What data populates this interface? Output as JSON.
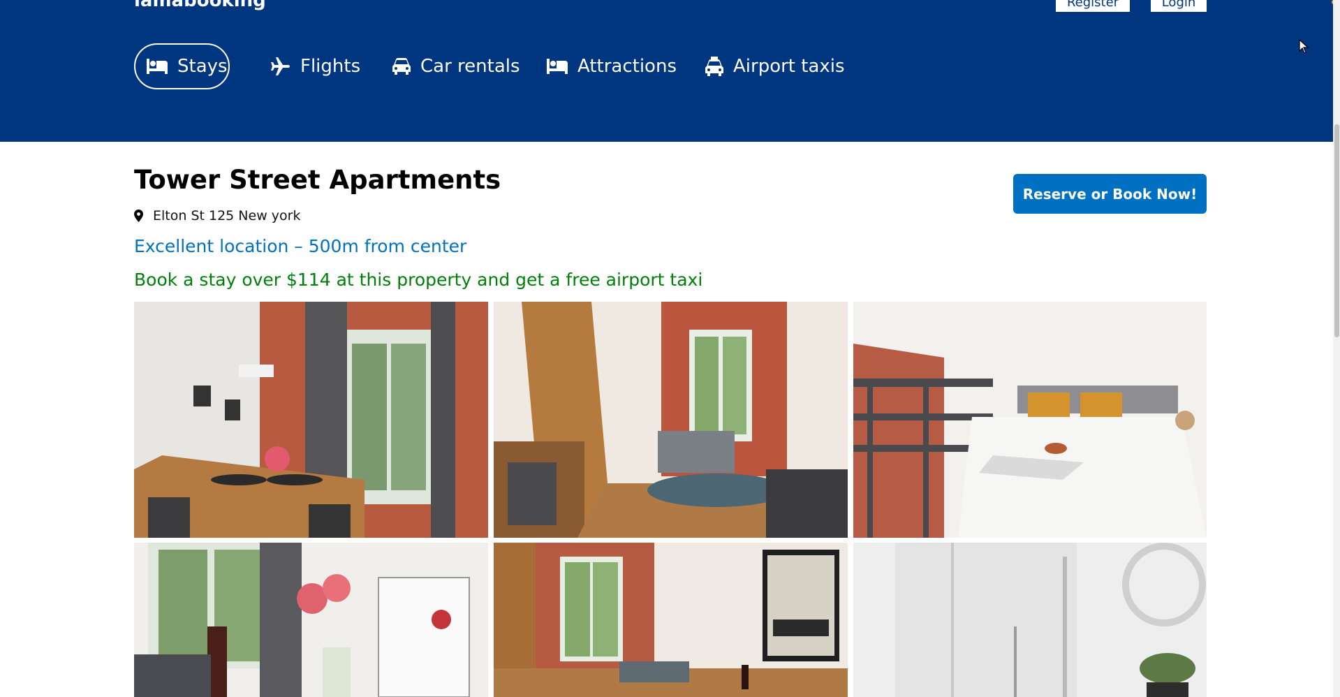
{
  "header": {
    "logo": "lamabooking",
    "register_label": "Register",
    "login_label": "Login",
    "nav": [
      {
        "label": "Stays",
        "icon": "bed-icon",
        "active": true
      },
      {
        "label": "Flights",
        "icon": "plane-icon",
        "active": false
      },
      {
        "label": "Car rentals",
        "icon": "car-icon",
        "active": false
      },
      {
        "label": "Attractions",
        "icon": "bed-icon",
        "active": false
      },
      {
        "label": "Airport taxis",
        "icon": "taxi-icon",
        "active": false
      }
    ]
  },
  "hotel": {
    "title": "Tower Street Apartments",
    "address": "Elton St 125 New york",
    "location_note": "Excellent location – 500m from center",
    "price_highlight": "Book a stay over $114 at this property and get a free airport taxi",
    "book_button": "Reserve or Book Now!"
  },
  "colors": {
    "header_bg": "#003580",
    "accent_blue": "#0071c2",
    "promo_green": "#008009"
  }
}
